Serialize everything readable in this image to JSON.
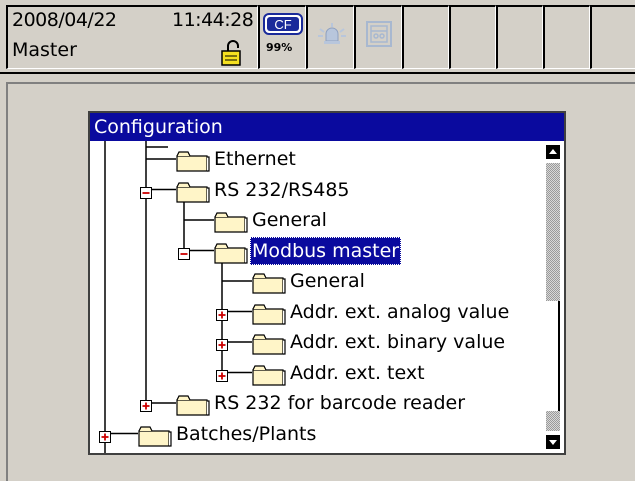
{
  "status_bar": {
    "date": "2008/04/22",
    "time": "11:44:28",
    "user": "Master",
    "cf_label": "CF",
    "cf_percent": "99%"
  },
  "icons": {
    "lock": "padlock-open-icon",
    "cf": "compact-flash-icon",
    "alarm": "alarm-bell-icon",
    "batch": "batch-report-icon"
  },
  "colors": {
    "title_bar": "#0a0a9e",
    "background": "#d4d0c8",
    "folder": "#fff5c8",
    "expander_mark": "#cc0000"
  },
  "config_window": {
    "title": "Configuration",
    "tree": [
      {
        "label": "Ethernet",
        "level": 2,
        "expander": "none"
      },
      {
        "label": "RS 232/RS485",
        "level": 2,
        "expander": "minus"
      },
      {
        "label": "General",
        "level": 3,
        "expander": "none"
      },
      {
        "label": "Modbus master",
        "level": 3,
        "expander": "minus",
        "selected": true
      },
      {
        "label": "General",
        "level": 4,
        "expander": "none"
      },
      {
        "label": "Addr. ext. analog value",
        "level": 4,
        "expander": "plus"
      },
      {
        "label": "Addr. ext. binary value",
        "level": 4,
        "expander": "plus"
      },
      {
        "label": "Addr. ext. text",
        "level": 4,
        "expander": "plus"
      },
      {
        "label": "RS 232 for barcode reader",
        "level": 2,
        "expander": "plus"
      },
      {
        "label": "Batches/Plants",
        "level": 1,
        "expander": "plus"
      }
    ]
  }
}
